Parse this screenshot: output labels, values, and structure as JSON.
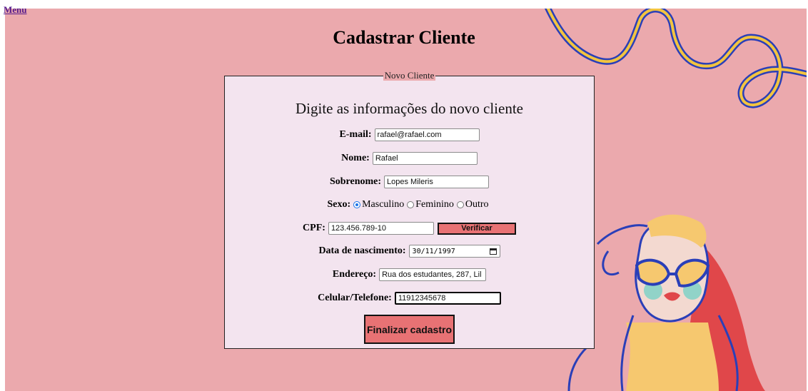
{
  "nav": {
    "menu_label": "Menu"
  },
  "page": {
    "title": "Cadastrar Cliente"
  },
  "form": {
    "legend": "Novo Cliente",
    "subtitle": "Digite as informações do novo cliente",
    "email": {
      "label": "E-mail:",
      "value": "rafael@rafael.com"
    },
    "nome": {
      "label": "Nome:",
      "value": "Rafael"
    },
    "sobrenome": {
      "label": "Sobrenome:",
      "value": "Lopes Mileris"
    },
    "sexo": {
      "label": "Sexo:",
      "options": [
        "Masculino",
        "Feminino",
        "Outro"
      ],
      "selected": "Masculino"
    },
    "cpf": {
      "label": "CPF:",
      "value": "123.456.789-10",
      "verify_label": "Verificar"
    },
    "nascimento": {
      "label": "Data de nascimento:",
      "value": "30/11/1997"
    },
    "endereco": {
      "label": "Endereço:",
      "value": "Rua dos estudantes, 287, Lil"
    },
    "telefone": {
      "label": "Celular/Telefone:",
      "value": "11912345678"
    },
    "submit_label": "Finalizar cadastro"
  },
  "colors": {
    "background": "#eba9ad",
    "panel": "#f3e4ef",
    "button": "#e87274",
    "link": "#551a8b"
  }
}
